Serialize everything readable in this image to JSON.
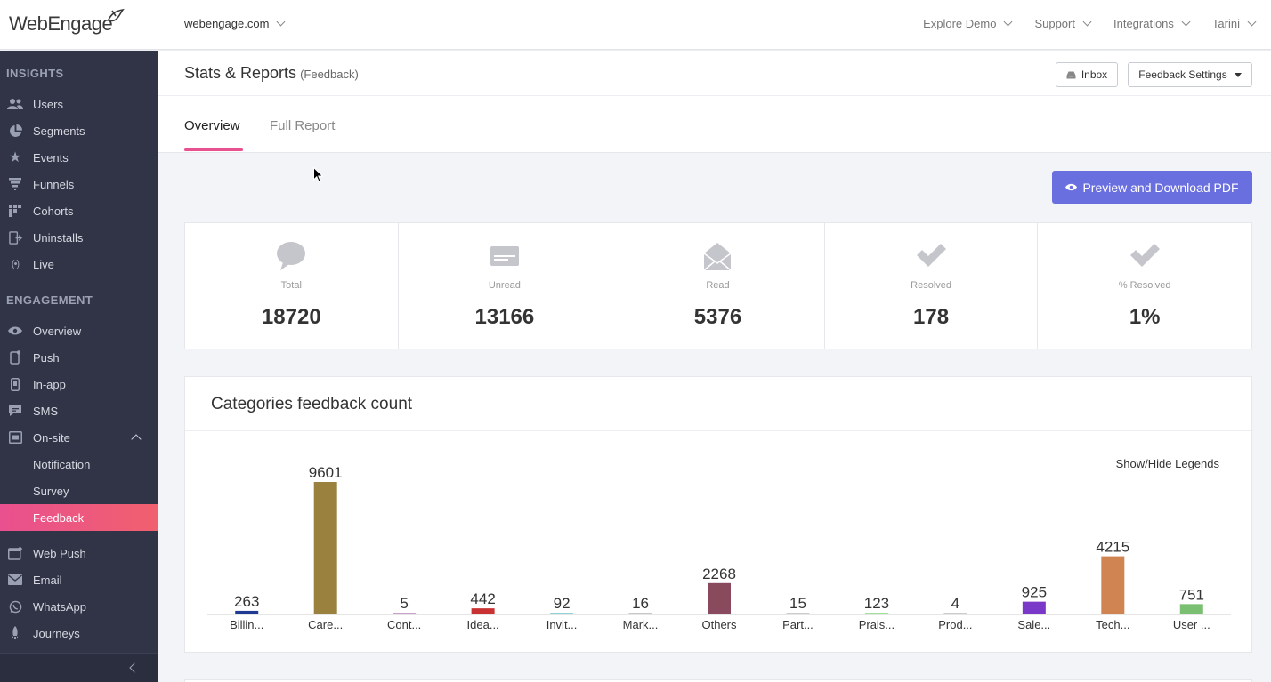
{
  "brand": {
    "logo_text": "WebEngage"
  },
  "topbar": {
    "project": "webengage.com",
    "nav": [
      "Explore Demo",
      "Support",
      "Integrations",
      "Tarini"
    ]
  },
  "sidebar": {
    "insights_title": "INSIGHTS",
    "insights": [
      {
        "label": "Users",
        "icon": "users-icon"
      },
      {
        "label": "Segments",
        "icon": "pie-icon"
      },
      {
        "label": "Events",
        "icon": "star-icon"
      },
      {
        "label": "Funnels",
        "icon": "funnel-icon"
      },
      {
        "label": "Cohorts",
        "icon": "grid-icon"
      },
      {
        "label": "Uninstalls",
        "icon": "exit-icon"
      },
      {
        "label": "Live",
        "icon": "broadcast-icon"
      }
    ],
    "engagement_title": "ENGAGEMENT",
    "engagement": [
      {
        "label": "Overview",
        "icon": "eye-icon"
      },
      {
        "label": "Push",
        "icon": "mobile-icon"
      },
      {
        "label": "In-app",
        "icon": "phone-icon"
      },
      {
        "label": "SMS",
        "icon": "chat-icon"
      },
      {
        "label": "On-site",
        "icon": "window-icon"
      },
      {
        "label": "Notification",
        "icon": ""
      },
      {
        "label": "Survey",
        "icon": ""
      },
      {
        "label": "Feedback",
        "icon": "",
        "active": true
      },
      {
        "label": "Web Push",
        "icon": "browser-icon"
      },
      {
        "label": "Email",
        "icon": "envelope-icon"
      },
      {
        "label": "WhatsApp",
        "icon": "whatsapp-icon"
      },
      {
        "label": "Journeys",
        "icon": "rocket-icon"
      }
    ]
  },
  "page": {
    "title": "Stats & Reports",
    "subtitle": "(Feedback)",
    "inbox_label": "Inbox",
    "settings_label": "Feedback Settings",
    "tabs": [
      "Overview",
      "Full Report"
    ],
    "pdf_label": "Preview and Download PDF"
  },
  "stats": [
    {
      "label": "Total",
      "value": "18720",
      "icon": "speech-bubble-icon"
    },
    {
      "label": "Unread",
      "value": "13166",
      "icon": "closed-envelope-icon"
    },
    {
      "label": "Read",
      "value": "5376",
      "icon": "open-envelope-icon"
    },
    {
      "label": "Resolved",
      "value": "178",
      "icon": "check-icon"
    },
    {
      "label": "% Resolved",
      "value": "1%",
      "icon": "check-icon"
    }
  ],
  "chart_card": {
    "title": "Categories feedback count",
    "legend_toggle": "Show/Hide Legends"
  },
  "chart_data": {
    "type": "bar",
    "title": "Categories feedback count",
    "categories": [
      "Billin...",
      "Care...",
      "Cont...",
      "Idea...",
      "Invit...",
      "Mark...",
      "Others",
      "Part...",
      "Prais...",
      "Prod...",
      "Sale...",
      "Tech...",
      "User ..."
    ],
    "values": [
      263,
      9601,
      5,
      442,
      92,
      16,
      2268,
      15,
      123,
      4,
      925,
      4215,
      751
    ],
    "colors": [
      "#1f3a93",
      "#9a813e",
      "#c9a1c9",
      "#c83232",
      "#8fd3d9",
      "#c7c7c7",
      "#8a4a5e",
      "#cccccc",
      "#9fe39a",
      "#cccccc",
      "#7a38c8",
      "#d08452",
      "#7bbf72"
    ],
    "ylim": [
      0,
      9601
    ],
    "xlabel": "",
    "ylabel": "",
    "grid": false
  }
}
